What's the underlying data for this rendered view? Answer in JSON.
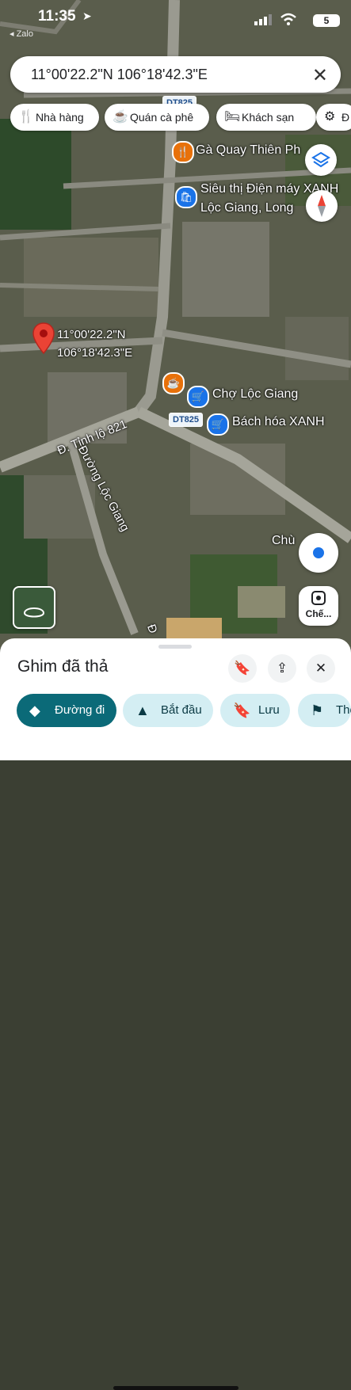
{
  "status_bar": {
    "time": "11:35",
    "back_label": "◂ Zalo",
    "battery": "5"
  },
  "search": {
    "value": "11°00'22.2\"N 106°18'42.3\"E"
  },
  "chips": [
    {
      "label": "Nhà hàng",
      "icon": "fork-knife-icon"
    },
    {
      "label": "Quán cà phê",
      "icon": "coffee-icon"
    },
    {
      "label": "Khách sạn",
      "icon": "bed-icon"
    },
    {
      "label": "Đ",
      "icon": "gear-icon"
    }
  ],
  "map": {
    "pin_label_line1": "11°00'22.2\"N",
    "pin_label_line2": "106°18'42.3\"E",
    "places": [
      {
        "name": "Gà Quay Thiên Ph",
        "icon": "fork-knife-icon",
        "color": "#e8710a"
      },
      {
        "name_line1": "Siêu thị Điện máy XANH",
        "name_line2": "Lộc Giang, Long",
        "icon": "shopping-bag-icon",
        "color": "#1a73e8"
      },
      {
        "name": "Chợ Lộc Giang",
        "icon": "shopping-cart-icon",
        "color": "#1a73e8"
      },
      {
        "name": "Bách hóa XANH",
        "icon": "shopping-cart-icon",
        "color": "#1a73e8"
      },
      {
        "name": "Chù",
        "icon": "none"
      }
    ],
    "coffee_icon_color": "#e8710a",
    "road_badges": [
      "DT825",
      "DT825"
    ],
    "road_labels": [
      "Đ. Tỉnh lộ 821",
      "Đường Lộc Giang",
      "Đ"
    ],
    "street_view_fab_label": "Chế..."
  },
  "sheet": {
    "title": "Ghim đã thả",
    "actions": [
      {
        "label": "Đường đi",
        "icon": "directions-icon",
        "primary": true
      },
      {
        "label": "Bắt đầu",
        "icon": "navigation-arrow-icon"
      },
      {
        "label": "Lưu",
        "icon": "bookmark-icon"
      },
      {
        "label": "Thê",
        "icon": "flag-icon"
      }
    ]
  },
  "colors": {
    "accent": "#0b6a78",
    "action_bg": "#d4eef3",
    "pin": "#ea4335",
    "location_blue": "#1a73e8"
  }
}
